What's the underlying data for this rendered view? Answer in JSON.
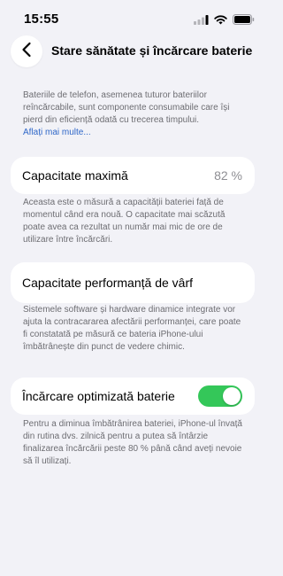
{
  "status_bar": {
    "time": "15:55",
    "icons": [
      "cellular-signal-icon",
      "wifi-icon",
      "battery-icon"
    ]
  },
  "nav": {
    "title": "Stare sănătate și încărcare baterie",
    "back_icon": "chevron-left-icon"
  },
  "intro": {
    "text": "Bateriile de telefon, asemenea tuturor bateriilor reîncărcabile, sunt componente consumabile care își pierd din eficiență odată cu trecerea timpului.",
    "link": "Aflați mai multe..."
  },
  "max_capacity": {
    "label": "Capacitate maximă",
    "value": "82 %",
    "note": "Aceasta este o măsură a capacității bateriei față de momentul când era nouă. O capacitate mai scăzută poate avea ca rezultat un număr mai mic de ore de utilizare între încărcări."
  },
  "peak_performance": {
    "label": "Capacitate performanță de vârf",
    "note": "Sistemele software și hardware dinamice integrate vor ajuta la contracararea afectării performanței, care poate fi constatată pe măsură ce bateria iPhone-ului îmbătrânește din punct de vedere chimic."
  },
  "optimized_charging": {
    "label": "Încărcare optimizată baterie",
    "enabled": true,
    "note": "Pentru a diminua îmbătrânirea bateriei, iPhone-ul învață din rutina dvs. zilnică pentru a putea să întârzie finalizarea încărcării peste 80 % până când aveți nevoie să îl utilizați."
  },
  "colors": {
    "background": "#f2f2f7",
    "card": "#ffffff",
    "link": "#2f67c8",
    "toggle_on": "#34c759",
    "secondary_text": "#6d6d72"
  }
}
